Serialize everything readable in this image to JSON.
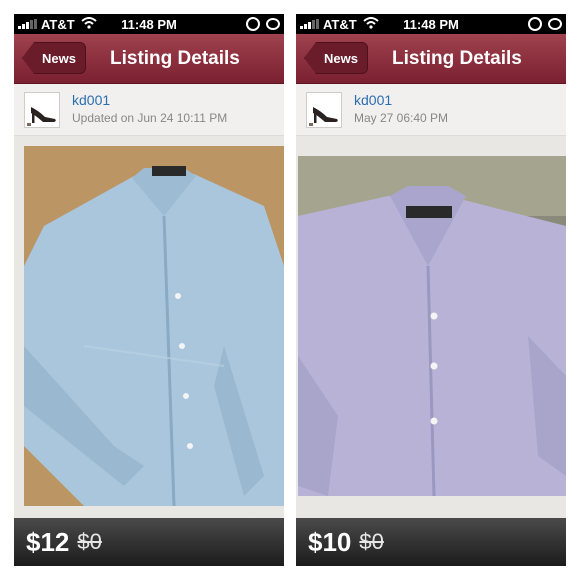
{
  "screens": [
    {
      "status": {
        "carrier": "AT&T",
        "time": "11:48 PM"
      },
      "nav": {
        "back_label": "News",
        "title": "Listing Details"
      },
      "listing": {
        "username": "kd001",
        "updated": "Updated on Jun 24 10:11 PM",
        "price": "$12",
        "original_price": "$0",
        "shirt_color": "#a9c6dc"
      }
    },
    {
      "status": {
        "carrier": "AT&T",
        "time": "11:48 PM"
      },
      "nav": {
        "back_label": "News",
        "title": "Listing Details"
      },
      "listing": {
        "username": "kd001",
        "updated": "May 27 06:40 PM",
        "price": "$10",
        "original_price": "$0",
        "shirt_color": "#b8b3d6"
      }
    }
  ],
  "colors": {
    "nav_bar": "#8c2e3b",
    "link": "#2a6fb0",
    "price_bar": "#2b2b2b"
  },
  "icons": [
    "wifi-icon",
    "orientation-lock-icon",
    "battery-icon",
    "signal-bars-icon"
  ]
}
